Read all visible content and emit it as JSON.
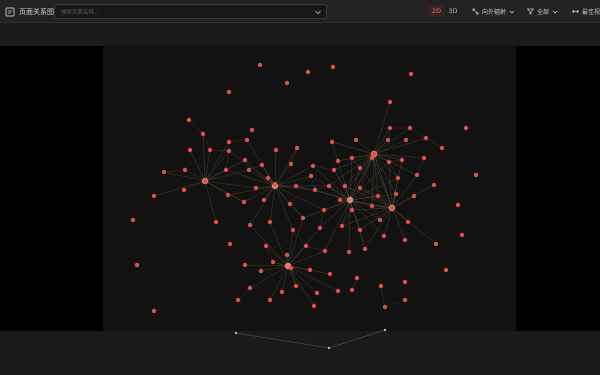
{
  "toolbar": {
    "title": "页面关系图",
    "title_icon": "graph-icon",
    "search_placeholder": "搜索页面名称...",
    "mode_2d": "2D",
    "mode_3d": "3D",
    "active_mode": "2D",
    "direction_label": "向外辐射",
    "filter_label": "全部",
    "fit_label": "最佳视"
  },
  "colors": {
    "node": "#d9534f",
    "accent": "#e86c6c",
    "edge": "#6b5a3e",
    "background": "#1b1b1b",
    "side_panel": "#000000"
  }
}
